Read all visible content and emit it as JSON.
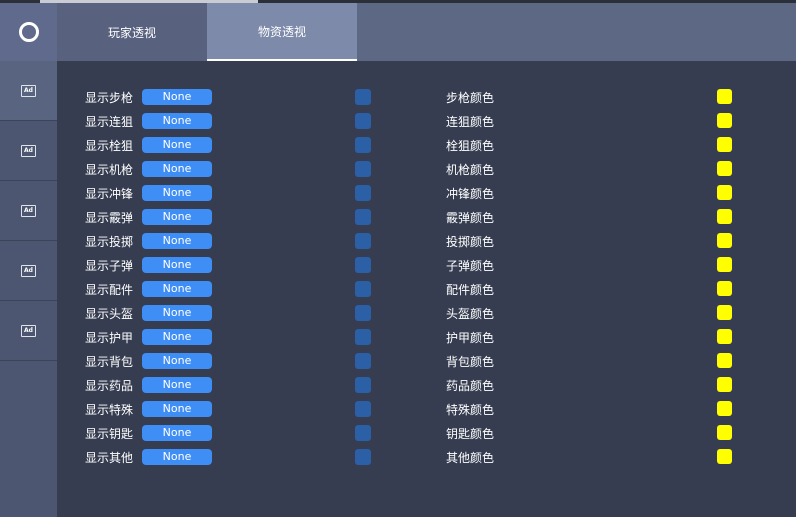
{
  "sidebar": {
    "logo_icon": "ring-icon",
    "items": [
      {
        "icon_text": "Ad",
        "icon": "ad-icon"
      },
      {
        "icon_text": "Ad",
        "icon": "ad-icon"
      },
      {
        "icon_text": "Ad",
        "icon": "ad-icon"
      },
      {
        "icon_text": "Ad",
        "icon": "ad-icon"
      },
      {
        "icon_text": "Ad",
        "icon": "ad-icon"
      }
    ]
  },
  "tabs": [
    {
      "label": "玩家透视"
    },
    {
      "label": "物资透视"
    }
  ],
  "active_tab": "物资透视",
  "rows": [
    {
      "show_label": "显示步枪",
      "value": "None",
      "color_label": "步枪颜色",
      "color": "#ffff00"
    },
    {
      "show_label": "显示连狙",
      "value": "None",
      "color_label": "连狙颜色",
      "color": "#ffff00"
    },
    {
      "show_label": "显示栓狙",
      "value": "None",
      "color_label": "栓狙颜色",
      "color": "#ffff00"
    },
    {
      "show_label": "显示机枪",
      "value": "None",
      "color_label": "机枪颜色",
      "color": "#ffff00"
    },
    {
      "show_label": "显示冲锋",
      "value": "None",
      "color_label": "冲锋颜色",
      "color": "#ffff00"
    },
    {
      "show_label": "显示霰弹",
      "value": "None",
      "color_label": "霰弹颜色",
      "color": "#ffff00"
    },
    {
      "show_label": "显示投掷",
      "value": "None",
      "color_label": "投掷颜色",
      "color": "#ffff00"
    },
    {
      "show_label": "显示子弹",
      "value": "None",
      "color_label": "子弹颜色",
      "color": "#ffff00"
    },
    {
      "show_label": "显示配件",
      "value": "None",
      "color_label": "配件颜色",
      "color": "#ffff00"
    },
    {
      "show_label": "显示头盔",
      "value": "None",
      "color_label": "头盔颜色",
      "color": "#ffff00"
    },
    {
      "show_label": "显示护甲",
      "value": "None",
      "color_label": "护甲颜色",
      "color": "#ffff00"
    },
    {
      "show_label": "显示背包",
      "value": "None",
      "color_label": "背包颜色",
      "color": "#ffff00"
    },
    {
      "show_label": "显示药品",
      "value": "None",
      "color_label": "药品颜色",
      "color": "#ffff00"
    },
    {
      "show_label": "显示特殊",
      "value": "None",
      "color_label": "特殊颜色",
      "color": "#ffff00"
    },
    {
      "show_label": "显示钥匙",
      "value": "None",
      "color_label": "钥匙颜色",
      "color": "#ffff00"
    },
    {
      "show_label": "显示其他",
      "value": "None",
      "color_label": "其他颜色",
      "color": "#ffff00"
    }
  ],
  "colors": {
    "accent_blue": "#3f8ef6",
    "toggle_blue": "#2b5fa6",
    "swatch_yellow": "#ffff00"
  }
}
